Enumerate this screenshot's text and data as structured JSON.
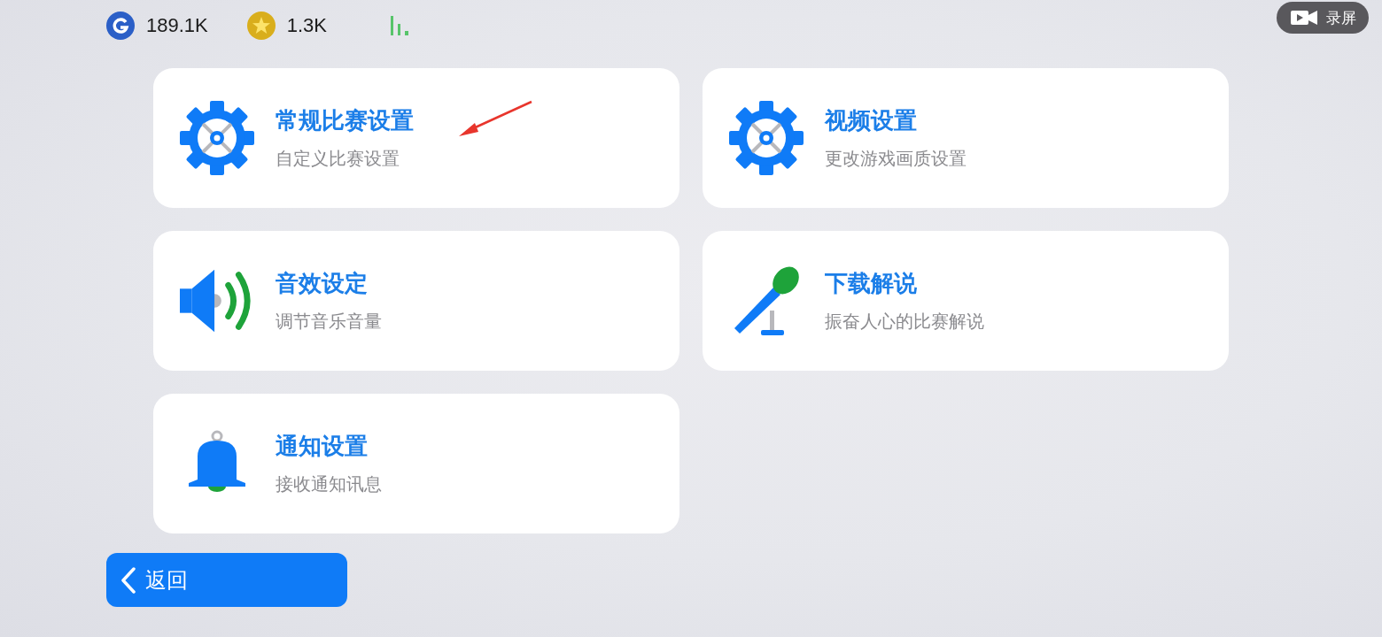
{
  "status_bar": {
    "coins": "189.1K",
    "stars": "1.3K"
  },
  "record_button": {
    "label": "录屏"
  },
  "cards": [
    {
      "kind": "gear",
      "title": "常规比赛设置",
      "subtitle": "自定义比赛设置"
    },
    {
      "kind": "gear",
      "title": "视频设置",
      "subtitle": "更改游戏画质设置"
    },
    {
      "kind": "speaker",
      "title": "音效设定",
      "subtitle": "调节音乐音量"
    },
    {
      "kind": "mic",
      "title": "下载解说",
      "subtitle": "振奋人心的比赛解说"
    },
    {
      "kind": "bell",
      "title": "通知设置",
      "subtitle": "接收通知讯息"
    }
  ],
  "back_button": {
    "label": "返回"
  }
}
